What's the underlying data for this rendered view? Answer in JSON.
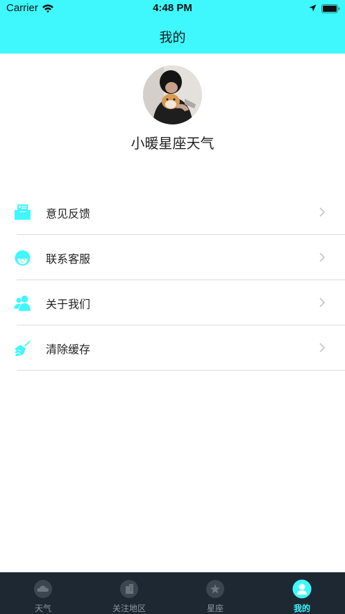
{
  "status_bar": {
    "carrier": "Carrier",
    "time": "4:48 PM",
    "icons": [
      "wifi-icon",
      "location-icon",
      "battery-icon"
    ]
  },
  "header": {
    "title": "我的",
    "background_color": "#3ef8fe"
  },
  "profile": {
    "name": "小暖星座天气"
  },
  "menu": {
    "items": [
      {
        "label": "意见反馈",
        "icon": "feedback-icon"
      },
      {
        "label": "联系客服",
        "icon": "customer-service-icon"
      },
      {
        "label": "关于我们",
        "icon": "about-us-icon"
      },
      {
        "label": "清除缓存",
        "icon": "broom-icon"
      }
    ],
    "icon_color": "#3ef8fe"
  },
  "tabbar": {
    "background_color": "#1d2833",
    "active_color": "#3ef8fe",
    "tabs": [
      {
        "label": "天气",
        "icon": "cloud-icon",
        "active": false
      },
      {
        "label": "关注地区",
        "icon": "building-icon",
        "active": false
      },
      {
        "label": "星座",
        "icon": "star-icon",
        "active": false
      },
      {
        "label": "我的",
        "icon": "person-icon",
        "active": true
      }
    ]
  }
}
